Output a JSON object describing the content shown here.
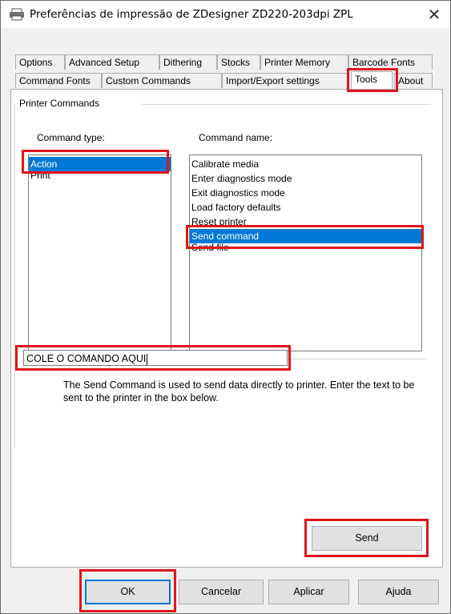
{
  "window": {
    "title": "Preferências de impressão de ZDesigner ZD220-203dpi ZPL",
    "close_glyph": "✕"
  },
  "tabs": {
    "row1": [
      "Options",
      "Advanced Setup",
      "Dithering",
      "Stocks",
      "Printer Memory",
      "Barcode Fonts"
    ],
    "row2": [
      "Command Fonts",
      "Custom Commands",
      "Import/Export settings",
      "Tools",
      "About"
    ],
    "active": "Tools"
  },
  "printer_commands": {
    "group_label": "Printer Commands",
    "command_type_label": "Command type:",
    "command_name_label": "Command name:",
    "command_types": [
      "Action",
      "Print"
    ],
    "selected_type": "Action",
    "command_names": [
      "Calibrate media",
      "Enter diagnostics mode",
      "Exit diagnostics mode",
      "Load factory defaults",
      "Reset printer",
      "Send command",
      "Send file"
    ],
    "selected_name": "Send command"
  },
  "description": {
    "input_value": "COLE O COMANDO AQUI",
    "text": "The Send Command is used to send data directly to printer. Enter the text to be sent to the printer in the box below."
  },
  "send_button": "Send",
  "footer": {
    "ok": "OK",
    "cancel": "Cancelar",
    "apply": "Aplicar",
    "help": "Ajuda"
  },
  "colors": {
    "selection": "#0078d7",
    "highlight_box": "#e1141c"
  },
  "icons": {
    "title_icon": "printer-icon"
  }
}
